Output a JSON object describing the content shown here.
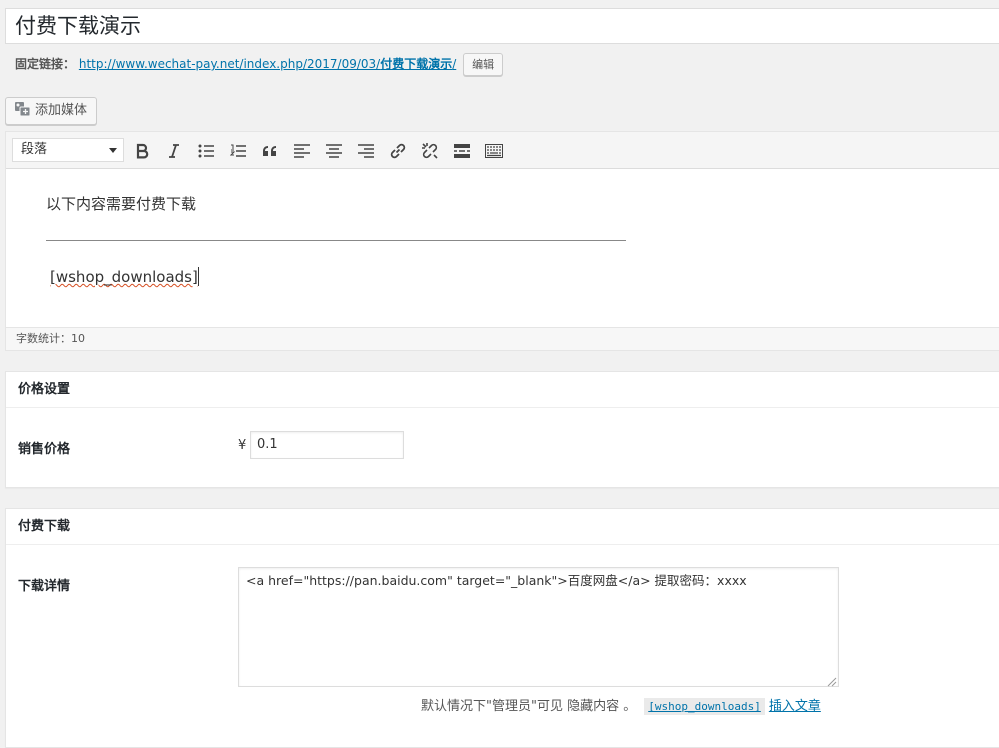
{
  "post": {
    "title": "付费下载演示",
    "permalink_label": "固定链接：",
    "permalink_base": "http://www.wechat-pay.net/index.php/2017/09/03/",
    "permalink_slug": "付费下载演示",
    "permalink_trail": "/",
    "edit_button": "编辑"
  },
  "media": {
    "add_media_label": "添加媒体"
  },
  "editor": {
    "format_select": "段落",
    "toolbar_icons": [
      "bold-icon",
      "italic-icon",
      "bullet-list-icon",
      "numbered-list-icon",
      "blockquote-icon",
      "align-left-icon",
      "align-center-icon",
      "align-right-icon",
      "link-icon",
      "unlink-icon",
      "read-more-icon",
      "toolbar-toggle-icon"
    ],
    "paragraph_1": "以下内容需要付费下载",
    "shortcode": "[wshop_downloads]",
    "word_count": "字数统计：10"
  },
  "price_box": {
    "title": "价格设置",
    "label": "销售价格",
    "currency": "¥",
    "value": "0.1"
  },
  "download_box": {
    "title": "付费下载",
    "label": "下载详情",
    "textarea_value": "<a href=\"https://pan.baidu.com\" target=\"_blank\">百度网盘</a> 提取密码：xxxx",
    "hint": "默认情况下\"管理员\"可见 隐藏内容 。",
    "shortcode_tag": "[wshop_downloads]",
    "insert_link": "插入文章"
  },
  "colors": {
    "link": "#0073aa",
    "background": "#f1f1f1"
  }
}
